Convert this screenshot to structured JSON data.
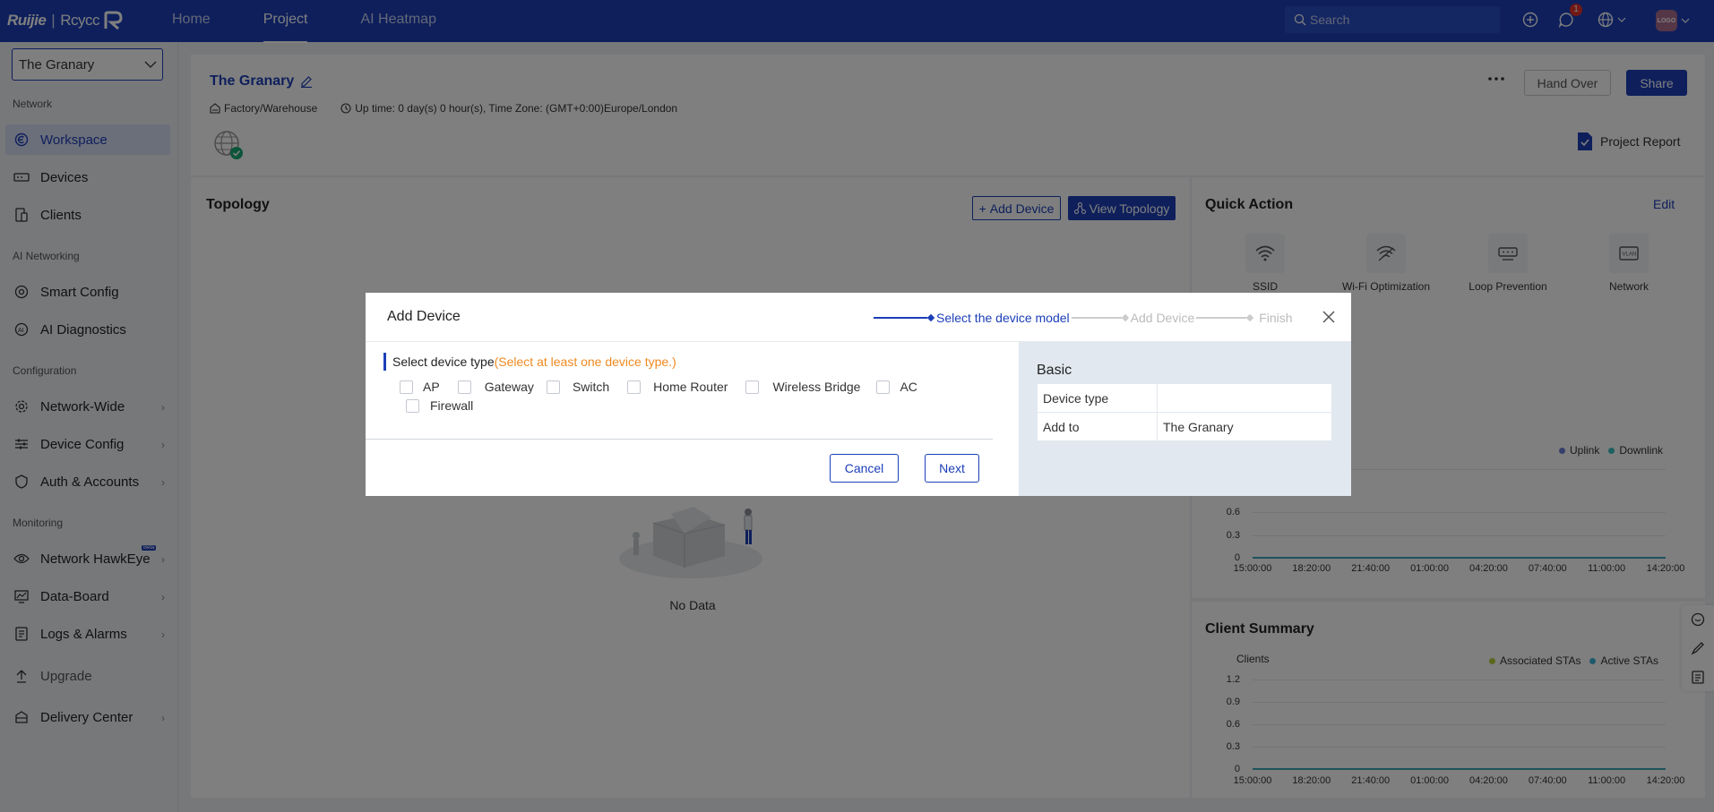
{
  "brand": {
    "logo_main": "Ruijie",
    "logo_sub": "Rcycc"
  },
  "topnav": [
    {
      "label": "Home",
      "active": false
    },
    {
      "label": "Project",
      "active": true
    },
    {
      "label": "AI Heatmap",
      "active": false
    }
  ],
  "top_search": {
    "placeholder": "Search"
  },
  "notifications": {
    "count": "1"
  },
  "avatar": {
    "text": "LOGO"
  },
  "sidebar": {
    "project": "The Granary",
    "sections": {
      "network": "Network",
      "ai": "AI Networking",
      "config": "Configuration",
      "monitoring": "Monitoring"
    },
    "items": {
      "workspace": "Workspace",
      "devices": "Devices",
      "clients": "Clients",
      "smart_config": "Smart Config",
      "ai_diagnostics": "AI Diagnostics",
      "network_wide": "Network-Wide",
      "device_config": "Device Config",
      "auth_accounts": "Auth & Accounts",
      "hawkeye": "Network HawkEye",
      "hawkeye_badge": "Beta",
      "data_board": "Data-Board",
      "logs_alarms": "Logs & Alarms",
      "upgrade": "Upgrade",
      "delivery_center": "Delivery Center"
    }
  },
  "project": {
    "title": "The Granary",
    "type": "Factory/Warehouse",
    "uptime": "Up time: 0 day(s) 0 hour(s), Time Zone: (GMT+0:00)Europe/London",
    "hand_over": "Hand Over",
    "share": "Share",
    "report": "Project Report"
  },
  "topology": {
    "title": "Topology",
    "add_device": "Add Device",
    "view_topology": "View Topology",
    "empty": "No Data"
  },
  "quick_action": {
    "title": "Quick Action",
    "edit": "Edit",
    "items": [
      {
        "label": "SSID",
        "icon": "wifi-icon"
      },
      {
        "label": "Wi-Fi Optimization",
        "icon": "wifi-optimize-icon"
      },
      {
        "label": "Loop Prevention",
        "icon": "loop-prevention-icon"
      },
      {
        "label": "Network",
        "icon": "vlan-icon"
      }
    ]
  },
  "traffic_chart": {
    "legend": [
      "Uplink",
      "Downlink"
    ],
    "yticks": [
      "0.6",
      "0.3",
      "0"
    ],
    "xticks": [
      "15:00:00",
      "18:20:00",
      "21:40:00",
      "01:00:00",
      "04:20:00",
      "07:40:00",
      "11:00:00",
      "14:20:00"
    ]
  },
  "client_summary": {
    "title": "Client Summary",
    "ylabel": "Clients",
    "legend": [
      "Associated STAs",
      "Active STAs"
    ],
    "yticks": [
      "1.2",
      "0.9",
      "0.6",
      "0.3",
      "0"
    ],
    "xticks": [
      "15:00:00",
      "18:20:00",
      "21:40:00",
      "01:00:00",
      "04:20:00",
      "07:40:00",
      "11:00:00",
      "14:20:00"
    ]
  },
  "colors": {
    "primary": "#1c3fb8",
    "uplink": "#6b7fd7",
    "downlink": "#3cc0c0",
    "associated": "#b7cf3a",
    "active": "#3cb4d8",
    "hint": "#f08a1f"
  },
  "modal": {
    "title": "Add Device",
    "steps": [
      "Select the device model",
      "Add Device",
      "Finish"
    ],
    "select_label": "Select device type",
    "select_hint": "(Select at least one device type.)",
    "device_types": [
      "AP",
      "Gateway",
      "Switch",
      "Home Router",
      "Wireless Bridge",
      "AC",
      "Firewall"
    ],
    "cancel": "Cancel",
    "next": "Next",
    "basic": {
      "title": "Basic",
      "device_type_label": "Device type",
      "device_type_value": "",
      "add_to_label": "Add to",
      "add_to_value": "The Granary"
    }
  }
}
